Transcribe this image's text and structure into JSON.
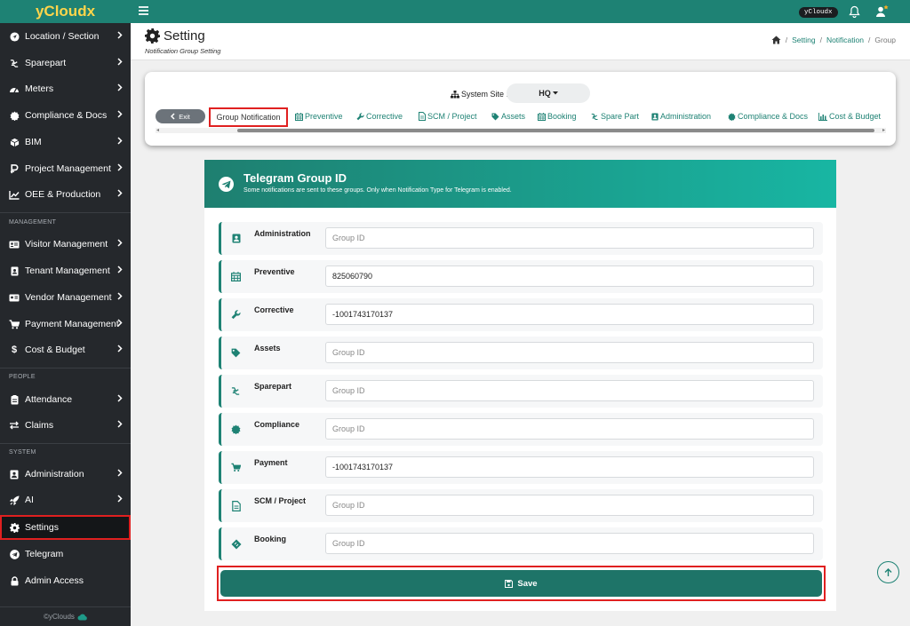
{
  "app": {
    "brand": "yCloudx",
    "user_badge": "yCloudx",
    "footer": "©yClouds"
  },
  "sidebar": {
    "items": [
      {
        "label": "Location / Section",
        "icon": "location-icon"
      },
      {
        "label": "Sparepart",
        "icon": "sparepart-icon"
      },
      {
        "label": "Meters",
        "icon": "meter-icon"
      },
      {
        "label": "Compliance & Docs",
        "icon": "certificate-icon"
      },
      {
        "label": "BIM",
        "icon": "bim-icon"
      },
      {
        "label": "Project Management",
        "icon": "project-icon"
      },
      {
        "label": "OEE & Production",
        "icon": "chart-line-icon"
      }
    ],
    "section_management": "MANAGEMENT",
    "management": [
      {
        "label": "Visitor Management",
        "icon": "id-card-icon"
      },
      {
        "label": "Tenant Management",
        "icon": "id-badge-icon"
      },
      {
        "label": "Vendor Management",
        "icon": "vendor-card-icon"
      },
      {
        "label": "Payment Management",
        "icon": "cart-icon"
      },
      {
        "label": "Cost & Budget",
        "icon": "dollar-icon"
      }
    ],
    "section_people": "PEOPLE",
    "people": [
      {
        "label": "Attendance",
        "icon": "clipboard-icon"
      },
      {
        "label": "Claims",
        "icon": "exchange-icon"
      }
    ],
    "section_system": "SYSTEM",
    "system": [
      {
        "label": "Administration",
        "icon": "admin-icon"
      },
      {
        "label": "AI",
        "icon": "rocket-icon"
      },
      {
        "label": "Settings",
        "icon": "gear-icon"
      },
      {
        "label": "Telegram",
        "icon": "telegram-icon"
      },
      {
        "label": "Admin Access",
        "icon": "lock-icon"
      }
    ]
  },
  "header": {
    "title": "Setting",
    "subtitle": "Notification Group Setting",
    "breadcrumb": [
      "Setting",
      "Notification",
      "Group"
    ]
  },
  "tabs_card": {
    "site_label": "System Site :",
    "site_value": "HQ",
    "exit_label": "Exit",
    "tabs": [
      {
        "label": "Group Notification",
        "icon": "",
        "active": true
      },
      {
        "label": "Preventive",
        "icon": "calendar-icon"
      },
      {
        "label": "Corrective",
        "icon": "wrench-icon"
      },
      {
        "label": "SCM / Project",
        "icon": "document-icon"
      },
      {
        "label": "Assets",
        "icon": "tag-icon"
      },
      {
        "label": "Booking",
        "icon": "calendar-icon"
      },
      {
        "label": "Spare Part",
        "icon": "sparepart-icon"
      },
      {
        "label": "Administration",
        "icon": "admin-icon"
      },
      {
        "label": "Compliance & Docs",
        "icon": "certificate-icon"
      },
      {
        "label": "Cost & Budget",
        "icon": "bar-chart-icon"
      }
    ]
  },
  "telegram": {
    "title": "Telegram Group ID",
    "description": "Some notifications are sent to these groups. Only when Notification Type for Telegram is enabled.",
    "placeholder": "Group ID",
    "rows": [
      {
        "label": "Administration",
        "value": "",
        "icon": "admin-icon"
      },
      {
        "label": "Preventive",
        "value": "825060790",
        "icon": "calendar-icon"
      },
      {
        "label": "Corrective",
        "value": "-1001743170137",
        "icon": "wrench-icon"
      },
      {
        "label": "Assets",
        "value": "",
        "icon": "tag-icon"
      },
      {
        "label": "Sparepart",
        "value": "",
        "icon": "sparepart-icon"
      },
      {
        "label": "Compliance",
        "value": "",
        "icon": "certificate-icon"
      },
      {
        "label": "Payment",
        "value": "-1001743170137",
        "icon": "cart-icon"
      },
      {
        "label": "SCM / Project",
        "value": "",
        "icon": "document-icon"
      },
      {
        "label": "Booking",
        "value": "",
        "icon": "ticket-icon"
      }
    ],
    "save_label": "Save"
  },
  "colors": {
    "primary": "#1e8274",
    "sidebar": "#25282c",
    "brand_text": "#ffd54a",
    "highlight": "#e02020"
  }
}
